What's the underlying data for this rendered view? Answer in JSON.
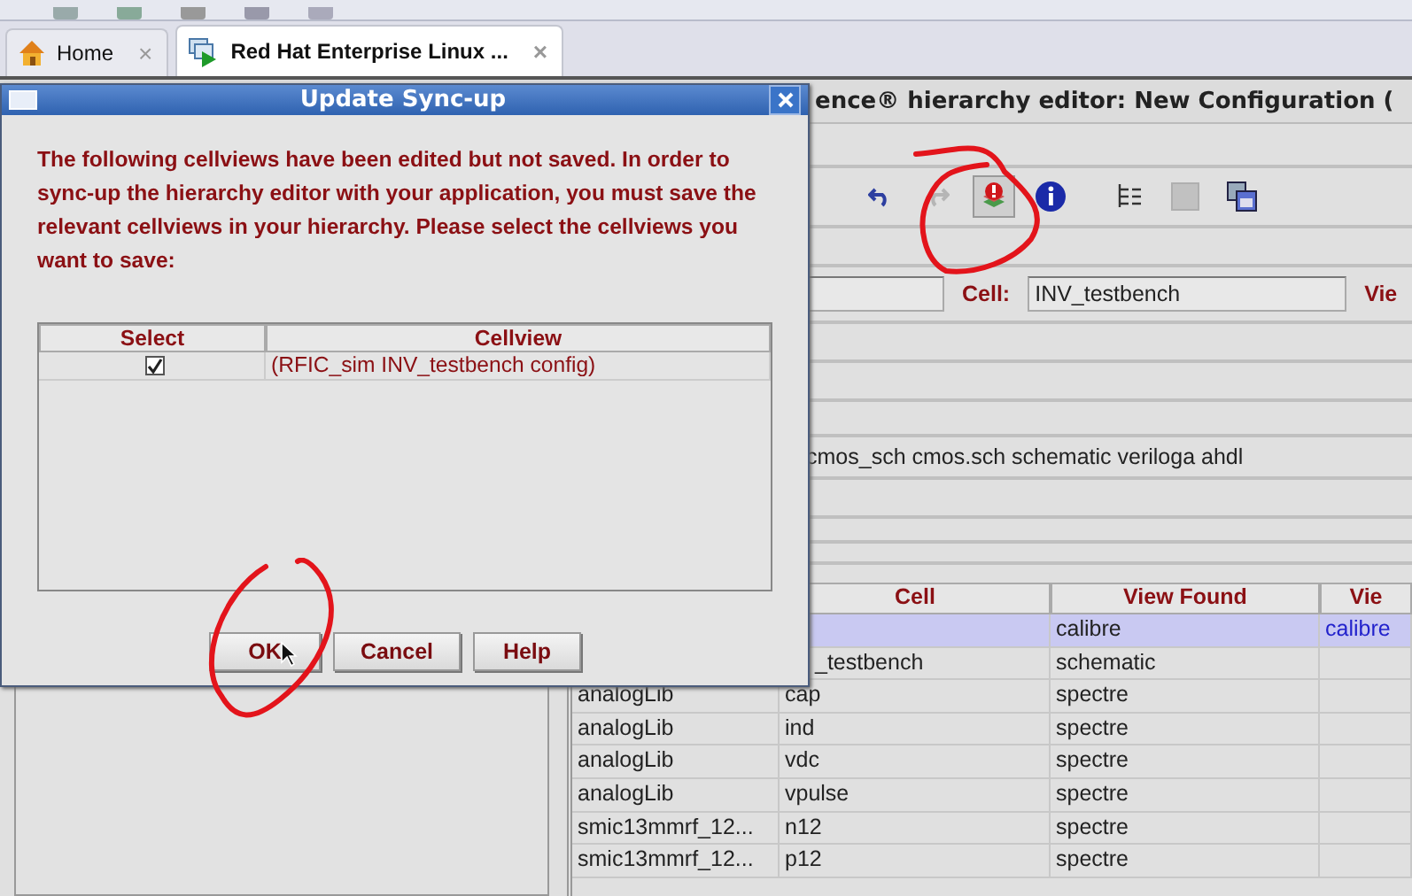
{
  "browser_tabs": [
    {
      "label": "Home",
      "selected": false,
      "close": "×"
    },
    {
      "label": "Red Hat Enterprise Linux ...",
      "selected": true,
      "close": "×"
    }
  ],
  "editor": {
    "title": "ence® hierarchy editor: New Configuration (",
    "toolbar": [
      {
        "kind": "undo",
        "disabled": false,
        "pressed": false
      },
      {
        "kind": "redo",
        "disabled": true,
        "pressed": false
      },
      {
        "kind": "update",
        "disabled": false,
        "pressed": true
      },
      {
        "kind": "info",
        "disabled": false,
        "pressed": false
      },
      {
        "kind": "tree",
        "disabled": false,
        "pressed": false
      },
      {
        "kind": "grid",
        "disabled": true,
        "pressed": false
      },
      {
        "kind": "windows",
        "disabled": false,
        "pressed": false
      }
    ],
    "cell_label": "Cell:",
    "cell_value": "INV_testbench",
    "view_label": "Vie",
    "view_list": "cmos_sch cmos.sch schematic veriloga ahdl",
    "table": {
      "columns": [
        "Cell",
        "View Found",
        "Vie"
      ],
      "rows": [
        {
          "view_found": "calibre",
          "view": "calibre",
          "selected": true
        },
        {
          "cell": "_testbench",
          "view_found": "schematic",
          "selected": false
        },
        {
          "library": "analogLib",
          "cell": "cap",
          "view_found": "spectre",
          "selected": false
        },
        {
          "library": "analogLib",
          "cell": "ind",
          "view_found": "spectre",
          "selected": false
        },
        {
          "library": "analogLib",
          "cell": "vdc",
          "view_found": "spectre",
          "selected": false
        },
        {
          "library": "analogLib",
          "cell": "vpulse",
          "view_found": "spectre",
          "selected": false
        },
        {
          "library": "smic13mmrf_12...",
          "cell": "n12",
          "view_found": "spectre",
          "selected": false
        },
        {
          "library": "smic13mmrf_12...",
          "cell": "p12",
          "view_found": "spectre",
          "selected": false
        }
      ]
    }
  },
  "dialog": {
    "title": "Update Sync-up",
    "message": "The following cellviews have been edited but not saved. In order to sync-up the hierarchy editor with your application, you must save the relevant cellviews in your hierarchy. Please select the cellviews you want to save:",
    "columns": [
      "Select",
      "Cellview"
    ],
    "rows": [
      {
        "checked": true,
        "cellview": "(RFIC_sim INV_testbench config)"
      }
    ],
    "buttons": [
      "OK",
      "Cancel",
      "Help"
    ]
  }
}
